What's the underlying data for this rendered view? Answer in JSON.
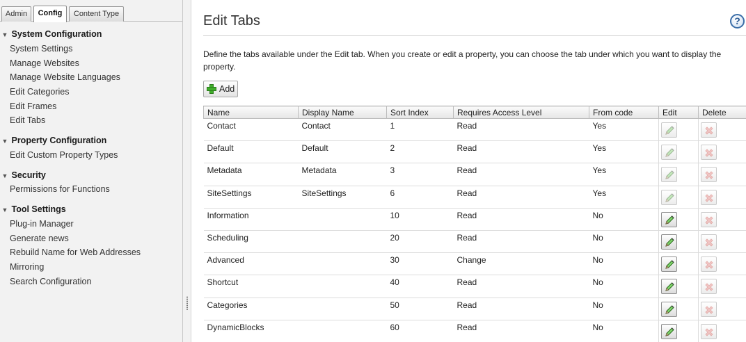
{
  "tabs": [
    {
      "label": "Admin",
      "active": false
    },
    {
      "label": "Config",
      "active": true
    },
    {
      "label": "Content Type",
      "active": false
    }
  ],
  "sidebar": {
    "groups": [
      {
        "title": "System Configuration",
        "items": [
          "System Settings",
          "Manage Websites",
          "Manage Website Languages",
          "Edit Categories",
          "Edit Frames",
          "Edit Tabs"
        ]
      },
      {
        "title": "Property Configuration",
        "items": [
          "Edit Custom Property Types"
        ]
      },
      {
        "title": "Security",
        "items": [
          "Permissions for Functions"
        ]
      },
      {
        "title": "Tool Settings",
        "items": [
          "Plug-in Manager",
          "Generate news",
          "Rebuild Name for Web Addresses",
          "Mirroring",
          "Search Configuration"
        ]
      }
    ]
  },
  "main": {
    "title": "Edit Tabs",
    "help_label": "?",
    "description": "Define the tabs available under the Edit tab. When you create or edit a property, you can choose the tab under which you want to display the property.",
    "add_label": "Add",
    "columns": [
      "Name",
      "Display Name",
      "Sort Index",
      "Requires Access Level",
      "From code",
      "Edit",
      "Delete"
    ],
    "rows": [
      {
        "name": "Contact",
        "display_name": "Contact",
        "sort_index": "1",
        "access": "Read",
        "from_code": "Yes",
        "editable": false
      },
      {
        "name": "Default",
        "display_name": "Default",
        "sort_index": "2",
        "access": "Read",
        "from_code": "Yes",
        "editable": false
      },
      {
        "name": "Metadata",
        "display_name": "Metadata",
        "sort_index": "3",
        "access": "Read",
        "from_code": "Yes",
        "editable": false
      },
      {
        "name": "SiteSettings",
        "display_name": "SiteSettings",
        "sort_index": "6",
        "access": "Read",
        "from_code": "Yes",
        "editable": false
      },
      {
        "name": "Information",
        "display_name": "",
        "sort_index": "10",
        "access": "Read",
        "from_code": "No",
        "editable": true
      },
      {
        "name": "Scheduling",
        "display_name": "",
        "sort_index": "20",
        "access": "Read",
        "from_code": "No",
        "editable": true
      },
      {
        "name": "Advanced",
        "display_name": "",
        "sort_index": "30",
        "access": "Change",
        "from_code": "No",
        "editable": true
      },
      {
        "name": "Shortcut",
        "display_name": "",
        "sort_index": "40",
        "access": "Read",
        "from_code": "No",
        "editable": true
      },
      {
        "name": "Categories",
        "display_name": "",
        "sort_index": "50",
        "access": "Read",
        "from_code": "No",
        "editable": true
      },
      {
        "name": "DynamicBlocks",
        "display_name": "",
        "sort_index": "60",
        "access": "Read",
        "from_code": "No",
        "editable": true
      }
    ]
  },
  "icons": {
    "edit": "pencil-icon",
    "delete": "delete-x-icon",
    "add": "plus-icon",
    "help": "help-icon",
    "collapse": "triangle-down-icon"
  },
  "colors": {
    "accent_green": "#3fae2a",
    "delete_red": "#d9534f",
    "help_blue": "#3b6ea8"
  }
}
